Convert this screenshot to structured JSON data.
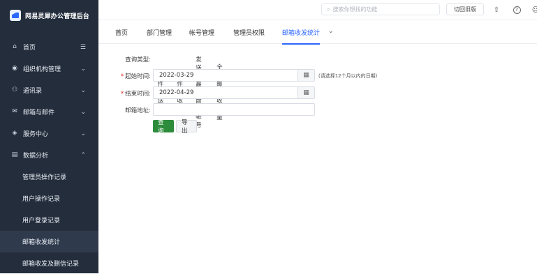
{
  "app": {
    "title": "网易灵犀办公管理后台",
    "logo_icon": "netease-logo-icon"
  },
  "sidebar": {
    "items": [
      {
        "label": "首页",
        "icon": "home-icon",
        "chev": "☰"
      },
      {
        "label": "组织机构管理",
        "icon": "org-icon",
        "chev": "⌄"
      },
      {
        "label": "通讯录",
        "icon": "contacts-icon",
        "chev": "⌄"
      },
      {
        "label": "邮箱与邮件",
        "icon": "mail-icon",
        "chev": "⌄"
      },
      {
        "label": "服务中心",
        "icon": "service-icon",
        "chev": "⌄"
      },
      {
        "label": "数据分析",
        "icon": "chart-icon",
        "chev": "⌃"
      }
    ],
    "sub_items": [
      {
        "label": "管理员操作记录",
        "active": false
      },
      {
        "label": "用户操作记录",
        "active": false
      },
      {
        "label": "用户登录记录",
        "active": false
      },
      {
        "label": "邮箱收发统计",
        "active": true
      },
      {
        "label": "邮箱收发及删信记录",
        "active": false
      }
    ]
  },
  "topbar": {
    "search_placeholder": "搜索你想找的功能",
    "switch_label": "切回旧版",
    "icons": [
      "upload-icon",
      "help-icon",
      "user-icon"
    ]
  },
  "tabs": {
    "items": [
      "首页",
      "部门管理",
      "帐号管理",
      "管理员权限",
      "邮箱收发统计"
    ],
    "active_index": 4,
    "more_icon": "⌄"
  },
  "form": {
    "query_type_label": "查询类型:",
    "query_types": [
      {
        "label": "邮件发送量",
        "selected": true
      },
      {
        "label": "邮件接收量",
        "selected": false
      },
      {
        "label": "发送量最大前15帐号",
        "selected": false
      },
      {
        "label": "全域邮件收发量",
        "selected": false
      }
    ],
    "start_label": "起始时间:",
    "start_value": "2022-03-29",
    "end_label": "结束时间:",
    "end_value": "2022-04-29",
    "date_hint": "(请选择12个月以内的日期)",
    "email_label": "邮箱地址:",
    "email_value": "",
    "query_button": "查询",
    "export_button": "导出"
  },
  "colors": {
    "sidebar_bg": "#232d3c",
    "accent": "#2b66ff",
    "primary_button": "#2d8c3c",
    "required": "#e2231a"
  }
}
